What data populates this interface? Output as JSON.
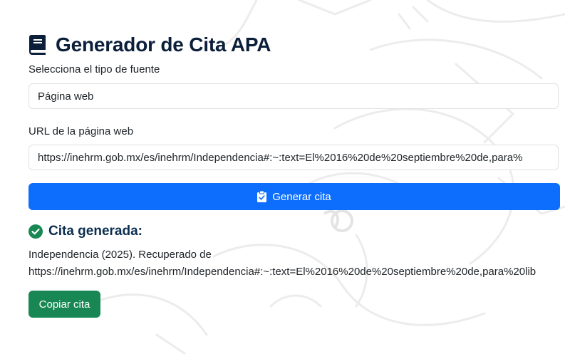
{
  "header": {
    "title": "Generador de Cita APA",
    "icon": "book-icon"
  },
  "source_type": {
    "label": "Selecciona el tipo de fuente",
    "value": "Página web"
  },
  "url_field": {
    "label": "URL de la página web",
    "value": "https://inehrm.gob.mx/es/inehrm/Independencia#:~:text=El%2016%20de%20septiembre%20de,para%"
  },
  "generate_button": {
    "label": "Generar cita",
    "icon": "clipboard-check-icon",
    "color": "#0d6efd"
  },
  "result": {
    "icon": "check-circle-icon",
    "title": "Cita generada:",
    "line1": "Independencia (2025). Recuperado de",
    "line2": "https://inehrm.gob.mx/es/inehrm/Independencia#:~:text=El%2016%20de%20septiembre%20de,para%20lib"
  },
  "copy_button": {
    "label": "Copiar cita",
    "color": "#198754"
  }
}
